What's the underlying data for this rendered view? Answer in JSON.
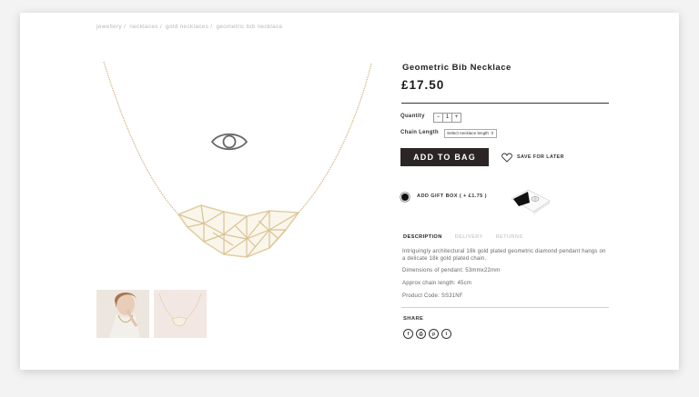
{
  "breadcrumb": [
    "jewellery",
    "necklaces",
    "gold necklaces",
    "geometric bib necklace"
  ],
  "breadcrumb_separator": "/",
  "product": {
    "title": "Geometric Bib Necklace",
    "price": "£17.50"
  },
  "options": {
    "quantity_label": "Quantity",
    "quantity_minus": "−",
    "quantity_value": "1",
    "quantity_plus": "+",
    "chain_label": "Chain Length",
    "chain_select_value": "Select necklace length"
  },
  "actions": {
    "add_to_bag": "ADD TO BAG",
    "save_for_later": "SAVE FOR LATER"
  },
  "gift": {
    "label": "ADD GIFT BOX ( + £1.75 )",
    "selected": true
  },
  "tabs": [
    {
      "label": "DESCRIPTION",
      "active": true
    },
    {
      "label": "DELIVERY",
      "active": false
    },
    {
      "label": "RETURNS",
      "active": false
    }
  ],
  "description": {
    "text": "Intriguingly architectural 18k gold plated geometric diamond pendant hangs on a delicate 18k gold plated chain.",
    "dimensions": "Dimensions of pendant: 53mmx22mm",
    "chain_length": "Approx chain length: 45cm",
    "product_code": "Product Code: SS31NF"
  },
  "share": {
    "label": "SHARE",
    "icons": [
      "facebook-icon",
      "print-icon",
      "pinterest-icon",
      "twitter-icon"
    ]
  },
  "colors": {
    "button_bg": "#2b2525",
    "gold": "#d4b98a",
    "muted_text": "#b9b9b9"
  }
}
